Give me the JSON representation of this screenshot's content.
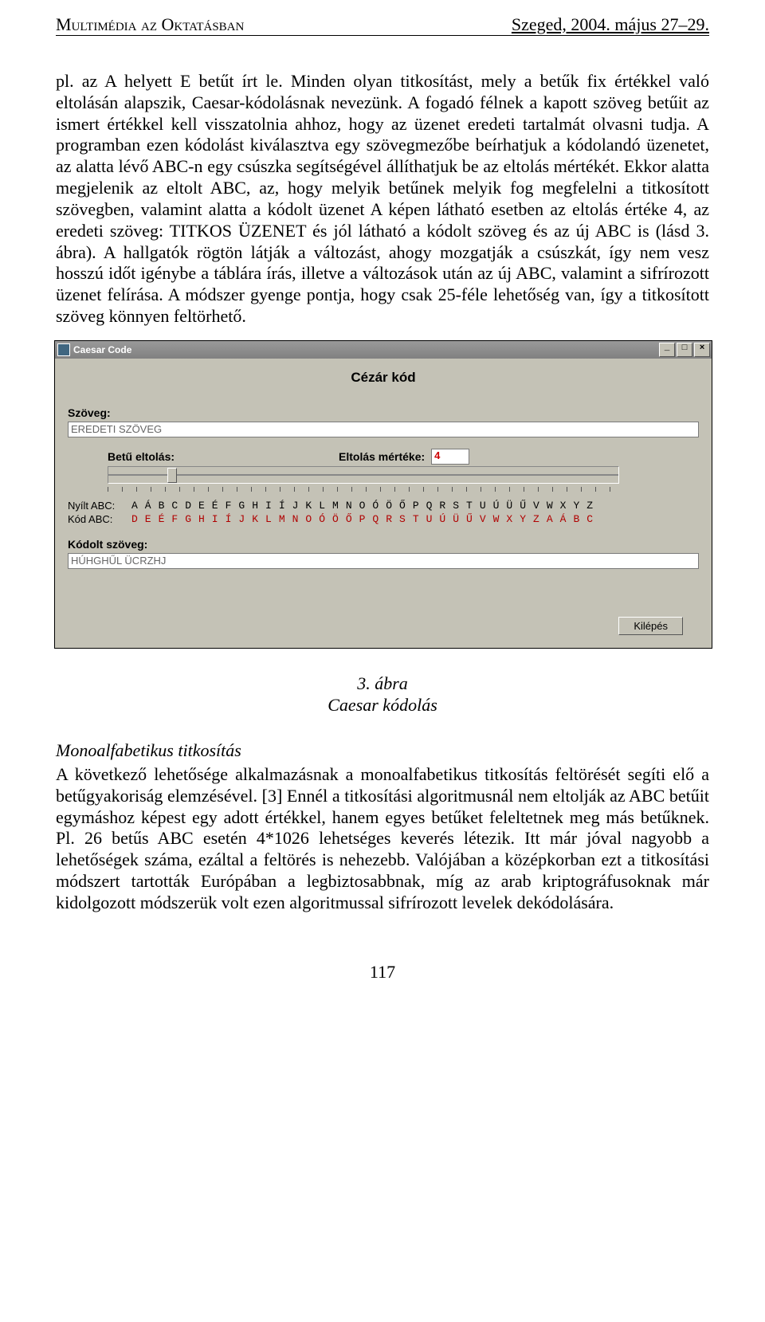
{
  "header": {
    "left": "Multimédia az Oktatásban",
    "right": "Szeged, 2004. május 27–29."
  },
  "para1": "pl. az A helyett E betűt írt le. Minden olyan titkosítást, mely a betűk fix értékkel való eltolásán alapszik, Caesar-kódolásnak nevezünk. A fogadó félnek a kapott szöveg betűit az ismert értékkel kell visszatolnia ahhoz, hogy az üzenet eredeti tartalmát olvasni tudja. A programban ezen kódolást kiválasztva egy szövegmezőbe beírhatjuk a kódolandó üzenetet, az alatta lévő ABC-n egy csúszka segítségével állíthatjuk be az eltolás mértékét. Ekkor alatta megjelenik az eltolt ABC, az, hogy melyik betűnek melyik fog megfelelni a titkosított szövegben, valamint alatta a kódolt üzenet A képen látható esetben az eltolás értéke 4, az eredeti szöveg: TITKOS ÜZENET és jól látható a kódolt szöveg és az új ABC is (lásd 3. ábra). A hallgatók rögtön látják a változást, ahogy mozgatják a csúszkát, így nem vesz hosszú időt igénybe a táblára írás, illetve a változások után az új ABC, valamint a sifrírozott üzenet felírása. A módszer gyenge pontja, hogy csak 25-féle lehetőség van, így a titkosított szöveg könnyen feltörhető.",
  "caption": {
    "line1": "3. ábra",
    "line2": "Caesar kódolás"
  },
  "subhead": "Monoalfabetikus titkosítás",
  "para2": "A következő lehetősége alkalmazásnak a monoalfabetikus titkosítás feltörését segíti elő a betűgyakoriság elemzésével. [3] Ennél a titkosítási algoritmusnál nem eltolják az ABC betűit egymáshoz képest egy adott értékkel, hanem egyes betűket feleltetnek meg más betűknek. Pl. 26 betűs ABC esetén 4*1026 lehetséges keverés létezik. Itt már jóval nagyobb a lehetőségek száma, ezáltal a feltörés is nehezebb. Valójában a középkorban ezt a titkosítási módszert tartották Európában a legbiztosabbnak, míg az arab kriptográfusoknak már kidolgozott módszerük volt ezen algoritmussal sifrírozott levelek dekódolására.",
  "page_number": "117",
  "window": {
    "title": "Caesar Code",
    "min": "_",
    "max": "□",
    "close": "×",
    "heading": "Cézár kód",
    "label_szoveg": "Szöveg:",
    "input_szoveg": "EREDETI SZÖVEG",
    "label_betu": "Betű eltolás:",
    "label_mertek": "Eltolás mértéke:",
    "mertek_value": "4",
    "label_nyilt": "Nyílt ABC:",
    "label_kod": "Kód ABC:",
    "nyilt_abc": "AÁBCDEÉFGHIÍJKLMNOÓÖŐPQRSTUÚÜŰVWXYZ",
    "kod_abc": "DEÉFGHIÍJKLMNOÓÖŐPQRSTUÚÜŰVWXYZAÁBC",
    "label_kodolt": "Kódolt szöveg:",
    "kodolt_value": "HÚHGHŰL ÜCRZHJ",
    "exit": "Kilépés"
  }
}
